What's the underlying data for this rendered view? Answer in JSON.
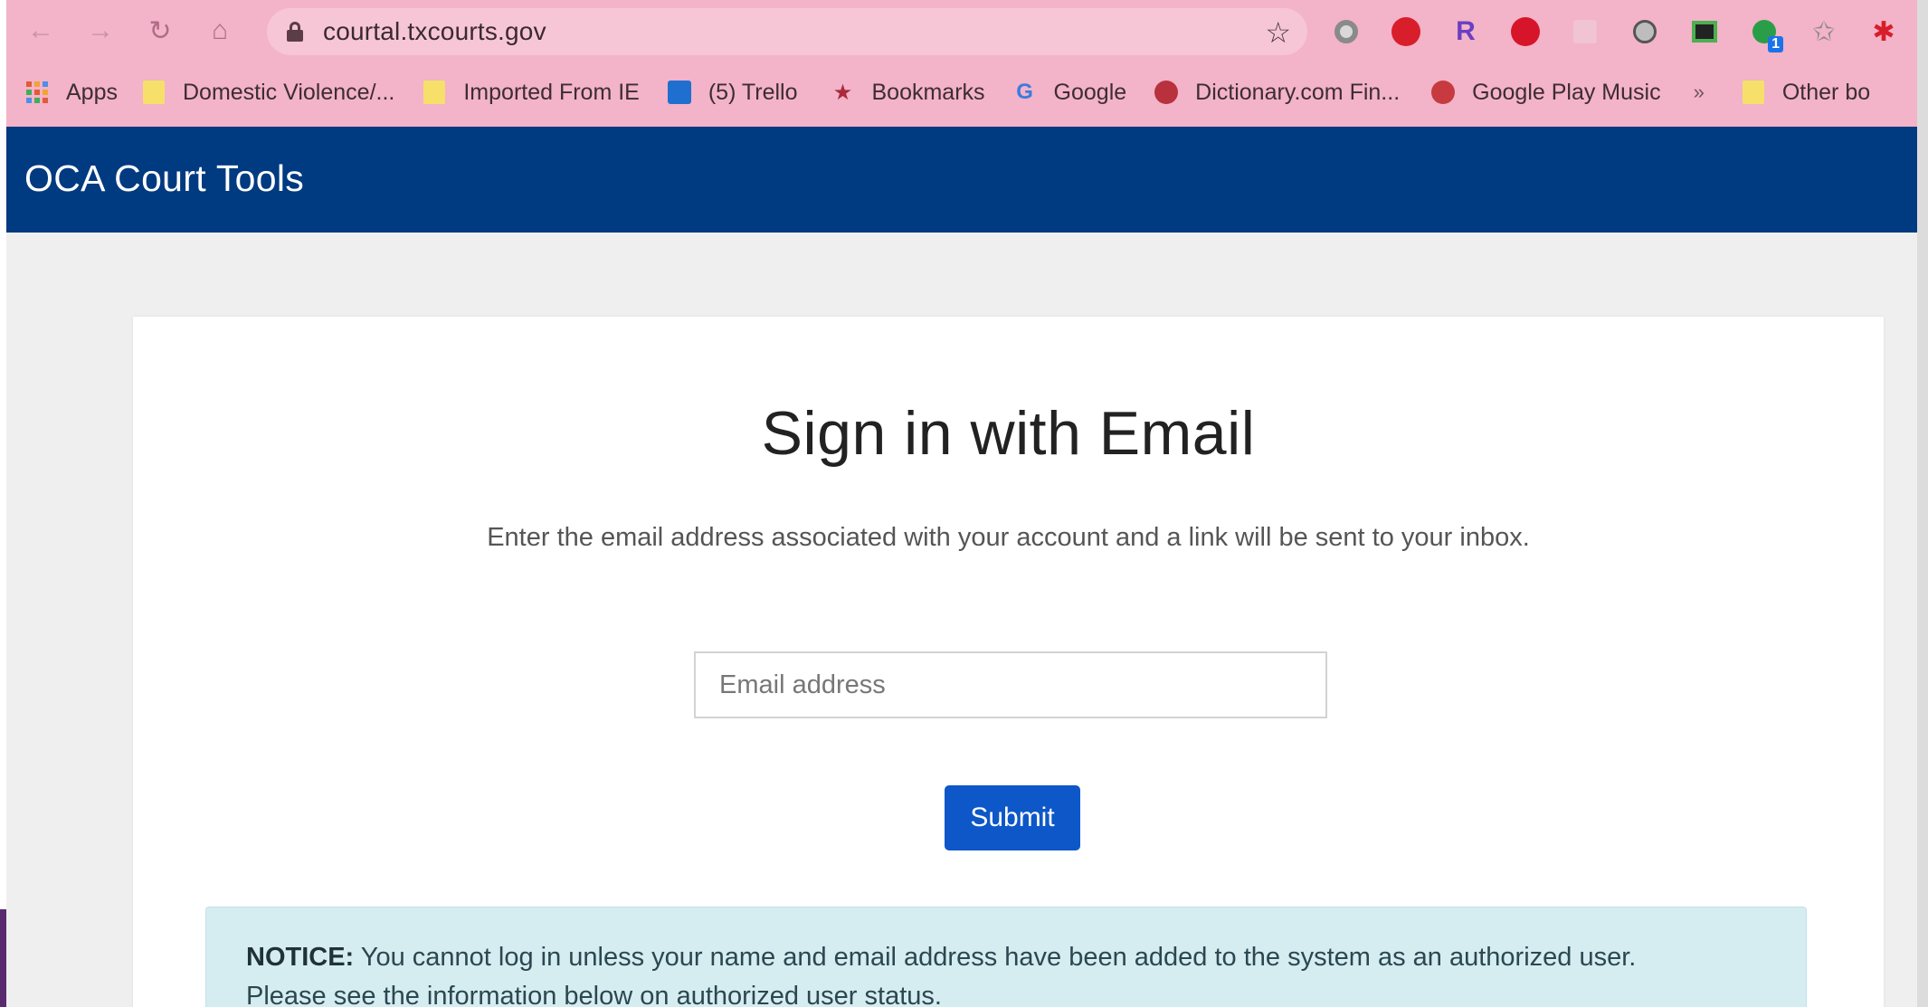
{
  "browser": {
    "url": "courtal.txcourts.gov",
    "bookmarks": [
      {
        "label": "Apps",
        "icon": "apps-grid-icon"
      },
      {
        "label": "Domestic Violence/...",
        "icon": "folder-icon"
      },
      {
        "label": "Imported From IE",
        "icon": "folder-icon"
      },
      {
        "label": "(5) Trello",
        "icon": "trello-icon"
      },
      {
        "label": "Bookmarks",
        "icon": "star-icon"
      },
      {
        "label": "Google",
        "icon": "google-icon"
      },
      {
        "label": "Dictionary.com Fin...",
        "icon": "dictionary-icon"
      },
      {
        "label": "Google Play Music",
        "icon": "play-music-icon"
      }
    ],
    "overflow_label": "»",
    "other_bookmarks": "Other bo",
    "extension_badge": "1"
  },
  "app": {
    "title": "OCA Court Tools"
  },
  "signin": {
    "title": "Sign in with Email",
    "subtitle": "Enter the email address associated with your account and a link will be sent to your inbox.",
    "email_placeholder": "Email address",
    "submit_label": "Submit"
  },
  "notice": {
    "label": "NOTICE:",
    "line1": "You cannot log in unless your name and email address have been added to the system as an authorized user.",
    "line2": "Please see the information below on authorized user status."
  },
  "colors": {
    "chrome_pink": "#f3b3c8",
    "header_navy": "#003a80",
    "submit_blue": "#0d57c8",
    "notice_bg": "#d5ecf1"
  }
}
